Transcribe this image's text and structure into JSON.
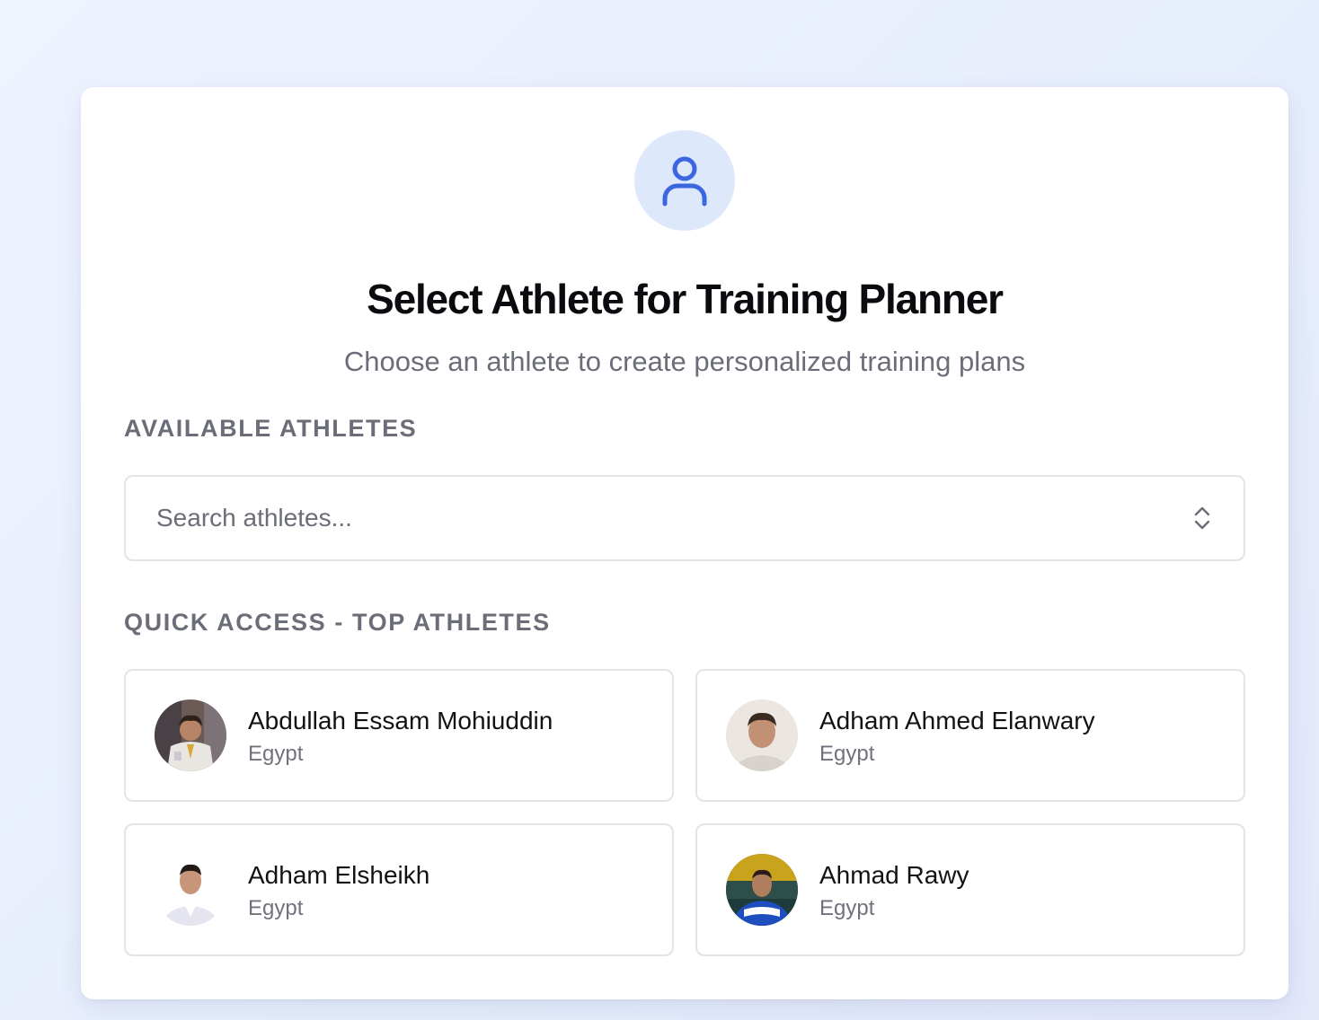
{
  "header": {
    "icon": "user-icon",
    "title": "Select Athlete for Training Planner",
    "subtitle": "Choose an athlete to create personalized training plans"
  },
  "available": {
    "label": "AVAILABLE ATHLETES",
    "search": {
      "value": "",
      "placeholder": "Search athletes...",
      "icon": "chevron-up-down-icon"
    }
  },
  "quick_access": {
    "label": "QUICK ACCESS - TOP ATHLETES",
    "athletes": [
      {
        "name": "Abdullah Essam Mohiuddin",
        "country": "Egypt",
        "avatar": "avatar-photo"
      },
      {
        "name": "Adham Ahmed Elanwary",
        "country": "Egypt",
        "avatar": "avatar-photo"
      },
      {
        "name": "Adham Elsheikh",
        "country": "Egypt",
        "avatar": "avatar-photo"
      },
      {
        "name": "Ahmad Rawy",
        "country": "Egypt",
        "avatar": "avatar-photo"
      }
    ]
  },
  "colors": {
    "accent": "#3b66e0",
    "icon_bg": "#dde8fb",
    "page_bg": "#e9effd",
    "border": "#e3e4e8",
    "muted_text": "#6b6e78"
  }
}
